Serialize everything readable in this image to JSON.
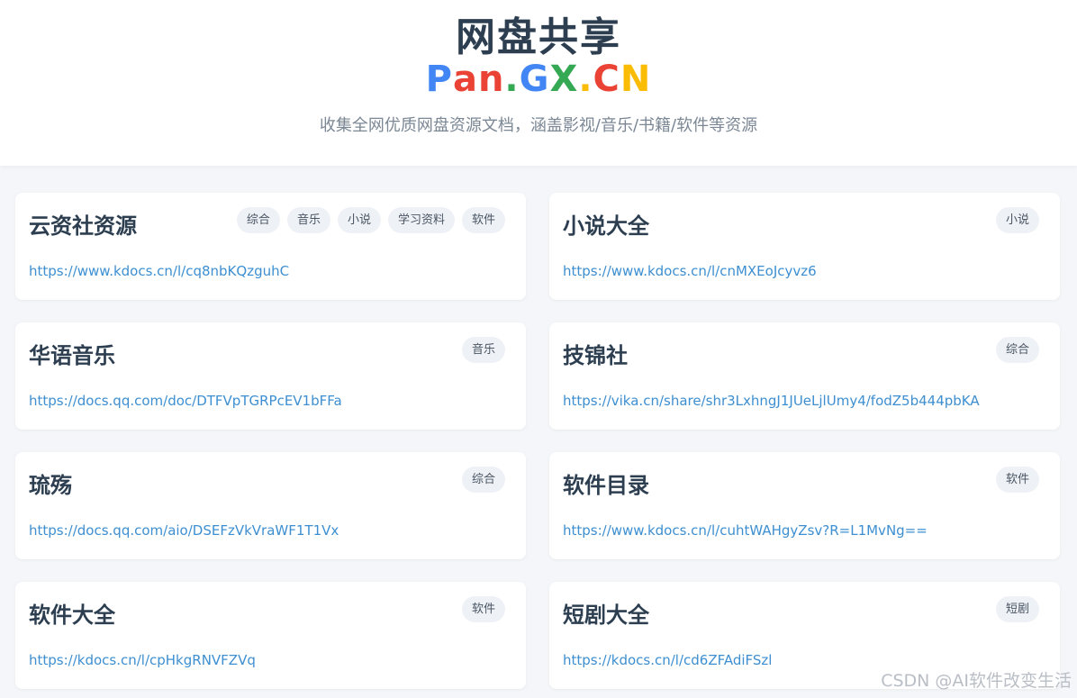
{
  "header": {
    "title": "网盘共享",
    "logo": [
      {
        "text": "P",
        "color": "#4285F4"
      },
      {
        "text": "an",
        "color": "#EA4335"
      },
      {
        "text": ".",
        "color": "#34A853"
      },
      {
        "text": "G",
        "color": "#4285F4"
      },
      {
        "text": "X",
        "color": "#34A853"
      },
      {
        "text": ".",
        "color": "#FBBC05"
      },
      {
        "text": "C",
        "color": "#EA4335"
      },
      {
        "text": "N",
        "color": "#FBBC05"
      }
    ],
    "subtitle": "收集全网优质网盘资源文档，涵盖影视/音乐/书籍/软件等资源"
  },
  "cards": [
    {
      "title": "云资社资源",
      "tags": [
        "综合",
        "音乐",
        "小说",
        "学习资料",
        "软件"
      ],
      "url": "https://www.kdocs.cn/l/cq8nbKQzguhC"
    },
    {
      "title": "小说大全",
      "tags": [
        "小说"
      ],
      "url": "https://www.kdocs.cn/l/cnMXEoJcyvz6"
    },
    {
      "title": "华语音乐",
      "tags": [
        "音乐"
      ],
      "url": "https://docs.qq.com/doc/DTFVpTGRPcEV1bFFa"
    },
    {
      "title": "技锦社",
      "tags": [
        "综合"
      ],
      "url": "https://vika.cn/share/shr3LxhngJ1JUeLjlUmy4/fodZ5b444pbKA"
    },
    {
      "title": "琉殇",
      "tags": [
        "综合"
      ],
      "url": "https://docs.qq.com/aio/DSEFzVkVraWF1T1Vx"
    },
    {
      "title": "软件目录",
      "tags": [
        "软件"
      ],
      "url": "https://www.kdocs.cn/l/cuhtWAHgyZsv?R=L1MvNg=="
    },
    {
      "title": "软件大全",
      "tags": [
        "软件"
      ],
      "url": "https://kdocs.cn/l/cpHkgRNVFZVq"
    },
    {
      "title": "短剧大全",
      "tags": [
        "短剧"
      ],
      "url": "https://kdocs.cn/l/cd6ZFAdiFSzl"
    }
  ],
  "watermark": "CSDN @AI软件改变生活"
}
